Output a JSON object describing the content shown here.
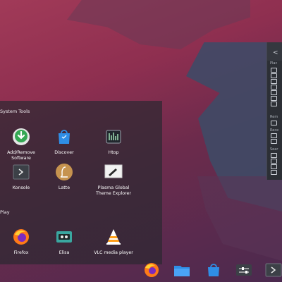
{
  "launcher": {
    "sections": [
      {
        "title": "System Tools",
        "apps": [
          {
            "name": "Add/Remove\nSoftware",
            "icon": "add-remove-software-icon"
          },
          {
            "name": "Discover",
            "icon": "discover-icon"
          },
          {
            "name": "Htop",
            "icon": "htop-icon"
          },
          {
            "name": "Konsole",
            "icon": "konsole-icon"
          },
          {
            "name": "Latte",
            "icon": "latte-icon"
          },
          {
            "name": "Plasma Global\nTheme Explorer",
            "icon": "theme-explorer-icon"
          }
        ]
      },
      {
        "title": "Play",
        "apps": [
          {
            "name": "Firefox",
            "icon": "firefox-icon"
          },
          {
            "name": "Elisa",
            "icon": "elisa-icon"
          },
          {
            "name": "VLC media player",
            "icon": "vlc-icon"
          }
        ]
      }
    ]
  },
  "side_panel": {
    "back_symbol": "<",
    "labels": [
      "Plac",
      "Rem",
      "Rece",
      "Sear"
    ]
  },
  "taskbar": {
    "items": [
      "firefox-icon",
      "folder-icon",
      "discover-icon",
      "settings-icon",
      "terminal-icon"
    ]
  }
}
